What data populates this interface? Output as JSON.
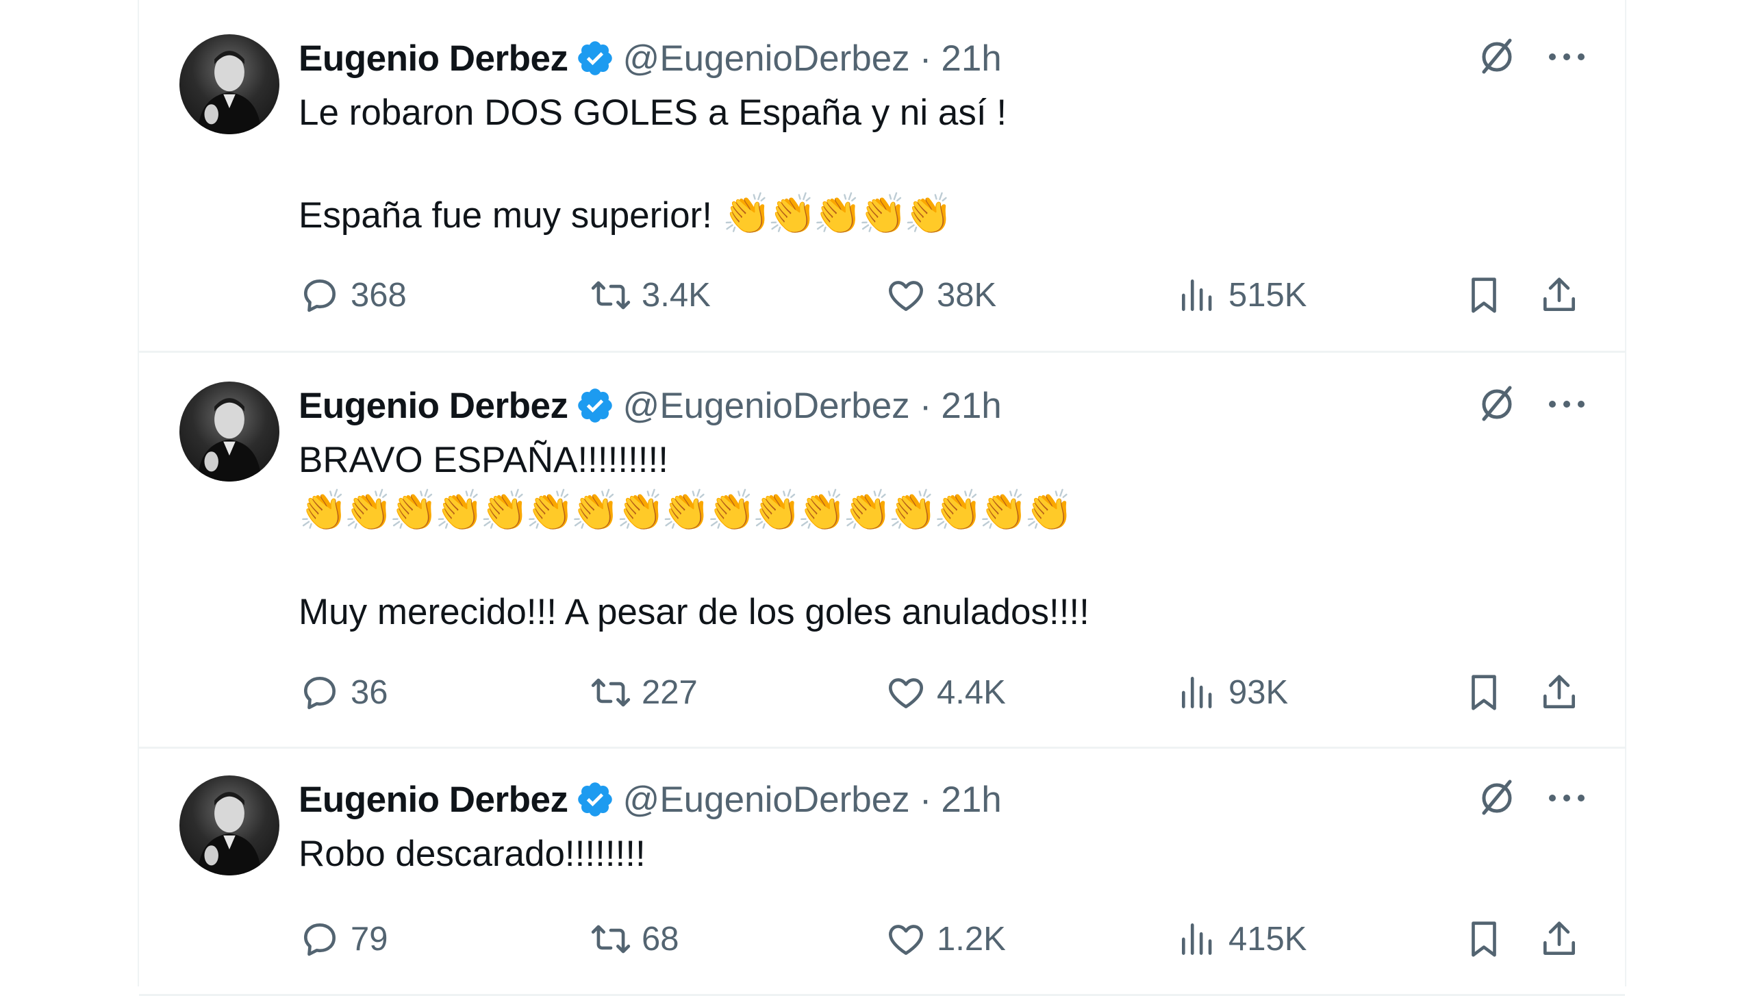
{
  "tweets": [
    {
      "name": "Eugenio Derbez",
      "handle": "@EugenioDerbez",
      "separator": "·",
      "time": "21h",
      "lines": [
        "Le robaron DOS GOLES a España y ni así !",
        "",
        "España fue muy superior! "
      ],
      "claps": [
        "👏👏👏👏👏"
      ],
      "replies": "368",
      "retweets": "3.4K",
      "likes": "38K",
      "views": "515K"
    },
    {
      "name": "Eugenio Derbez",
      "handle": "@EugenioDerbez",
      "separator": "·",
      "time": "21h",
      "lines": [
        "BRAVO ESPAÑA!!!!!!!!!",
        "",
        "",
        "Muy merecido!!! A pesar de los goles anulados!!!!"
      ],
      "claps": [
        "👏👏👏👏👏👏👏👏👏👏👏👏👏👏👏👏👏"
      ],
      "replies": "36",
      "retweets": "227",
      "likes": "4.4K",
      "views": "93K"
    },
    {
      "name": "Eugenio Derbez",
      "handle": "@EugenioDerbez",
      "separator": "·",
      "time": "21h",
      "lines": [
        "Robo descarado!!!!!!!!"
      ],
      "replies": "79",
      "retweets": "68",
      "likes": "1.2K",
      "views": "415K"
    }
  ],
  "icons": [
    "verified-badge-icon",
    "grok-icon",
    "more-icon",
    "reply-icon",
    "retweet-icon",
    "like-icon",
    "views-icon",
    "bookmark-icon",
    "share-icon"
  ],
  "colors": {
    "verified": "#1d9bf0",
    "secondary_text": "#536471",
    "divider": "#eff3f4"
  }
}
